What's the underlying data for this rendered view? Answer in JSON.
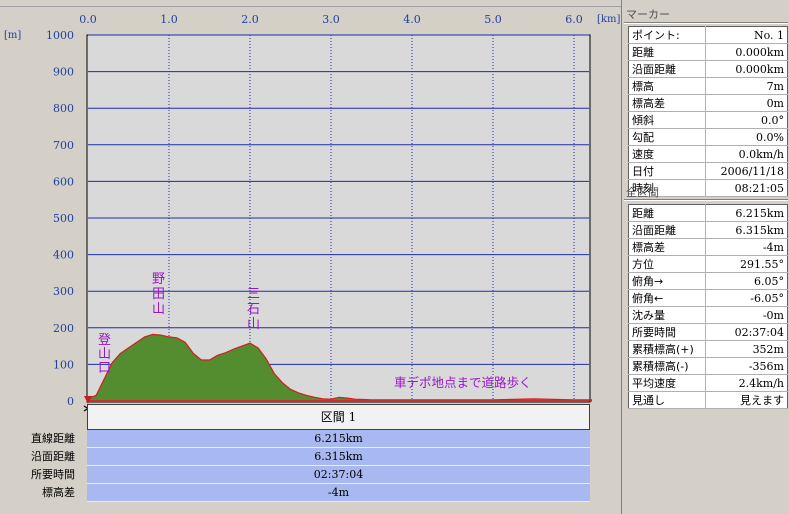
{
  "chart_data": {
    "type": "area",
    "x_ticks": [
      "0.0",
      "1.0",
      "2.0",
      "3.0",
      "4.0",
      "5.0",
      "6.0"
    ],
    "x_unit": "[km]",
    "y_ticks": [
      "1000",
      "900",
      "800",
      "700",
      "600",
      "500",
      "400",
      "300",
      "200",
      "100",
      "0"
    ],
    "y_unit": "[m]",
    "xlim": [
      0,
      6.215
    ],
    "ylim": [
      0,
      1000
    ],
    "series": [
      {
        "x": [
          0.0,
          0.1,
          0.2,
          0.3,
          0.4,
          0.5,
          0.6,
          0.7,
          0.8,
          0.9,
          1.0,
          1.1,
          1.2,
          1.3,
          1.4,
          1.5,
          1.6,
          1.7,
          1.8,
          1.9,
          2.0,
          2.1,
          2.2,
          2.3,
          2.4,
          2.5,
          2.6,
          2.7,
          2.8,
          2.9,
          3.0,
          3.1,
          3.2,
          3.3,
          3.4,
          3.5,
          4.0,
          4.5,
          5.0,
          5.5,
          6.0,
          6.215
        ],
        "y": [
          7,
          15,
          60,
          105,
          130,
          145,
          160,
          175,
          182,
          180,
          175,
          172,
          160,
          130,
          112,
          112,
          125,
          132,
          142,
          150,
          158,
          145,
          115,
          75,
          50,
          32,
          22,
          15,
          10,
          6,
          5,
          10,
          8,
          5,
          4,
          3,
          3,
          3,
          3,
          6,
          3,
          3
        ],
        "color": "#548c30"
      }
    ],
    "annotations": [
      {
        "text": "登山口"
      },
      {
        "text": "野田山"
      },
      {
        "text": "三石山"
      },
      {
        "text": "車デポ地点まで道路歩く"
      }
    ]
  },
  "section": {
    "header": "区間 1",
    "rows": [
      {
        "label": "直線距離",
        "value": "6.215km"
      },
      {
        "label": "沿面距離",
        "value": "6.315km"
      },
      {
        "label": "所要時間",
        "value": "02:37:04"
      },
      {
        "label": "標高差",
        "value": "-4m"
      }
    ]
  },
  "marker": {
    "title": "マーカー",
    "rows": [
      {
        "key": "ポイント:",
        "value": "No. 1"
      },
      {
        "key": "距離",
        "value": "0.000km"
      },
      {
        "key": "沿面距離",
        "value": "0.000km"
      },
      {
        "key": "標高",
        "value": "7m"
      },
      {
        "key": "標高差",
        "value": "0m"
      },
      {
        "key": "傾斜",
        "value": "0.0°"
      },
      {
        "key": "勾配",
        "value": "0.0%"
      },
      {
        "key": "速度",
        "value": "0.0km/h"
      },
      {
        "key": "日付",
        "value": "2006/11/18"
      },
      {
        "key": "時刻",
        "value": "08:21:05"
      }
    ]
  },
  "all_section": {
    "title": "全区間",
    "rows": [
      {
        "key": "距離",
        "value": "6.215km"
      },
      {
        "key": "沿面距離",
        "value": "6.315km"
      },
      {
        "key": "標高差",
        "value": "-4m"
      },
      {
        "key": "方位",
        "value": "291.55°"
      },
      {
        "key": "俯角→",
        "value": "6.05°"
      },
      {
        "key": "俯角←",
        "value": "-6.05°"
      },
      {
        "key": "沈み量",
        "value": "-0m"
      },
      {
        "key": "所要時間",
        "value": "02:37:04"
      },
      {
        "key": "累積標高(+)",
        "value": "352m"
      },
      {
        "key": "累積標高(-)",
        "value": "-356m"
      },
      {
        "key": "平均速度",
        "value": "2.4km/h"
      },
      {
        "key": "見通し",
        "value": "見えます"
      }
    ]
  }
}
